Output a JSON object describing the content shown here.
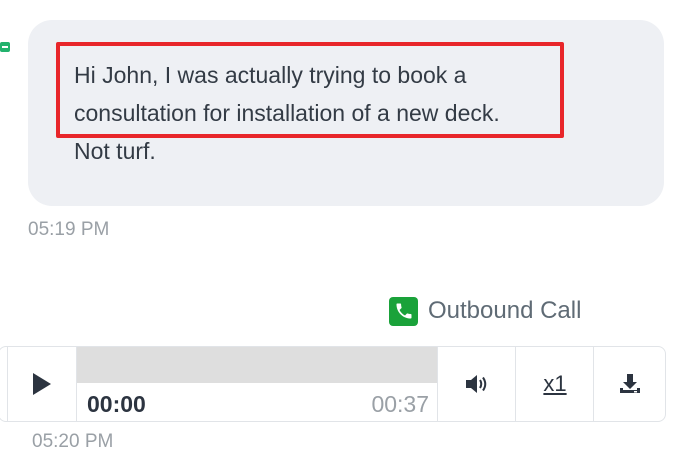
{
  "message": {
    "text": "Hi John, I was actually trying to book a consultation for installation of a new deck. Not turf.",
    "lines": [
      "Hi John, I was actually trying to book a",
      "consultation for installation of a new deck.",
      "Not turf."
    ],
    "timestamp": "05:19 PM"
  },
  "call": {
    "label": "Outbound Call",
    "icon": "phone-icon",
    "icon_color": "#1aa23a"
  },
  "player": {
    "current_time": "00:00",
    "total_time": "00:37",
    "speed": "x1",
    "progress": 0,
    "icons": [
      "play-icon",
      "volume-icon",
      "download-icon"
    ]
  },
  "player_timestamp": "05:20 PM",
  "colors": {
    "bubble": "#eef0f4",
    "highlight": "#e8262a",
    "accent_green": "#23b26d"
  }
}
